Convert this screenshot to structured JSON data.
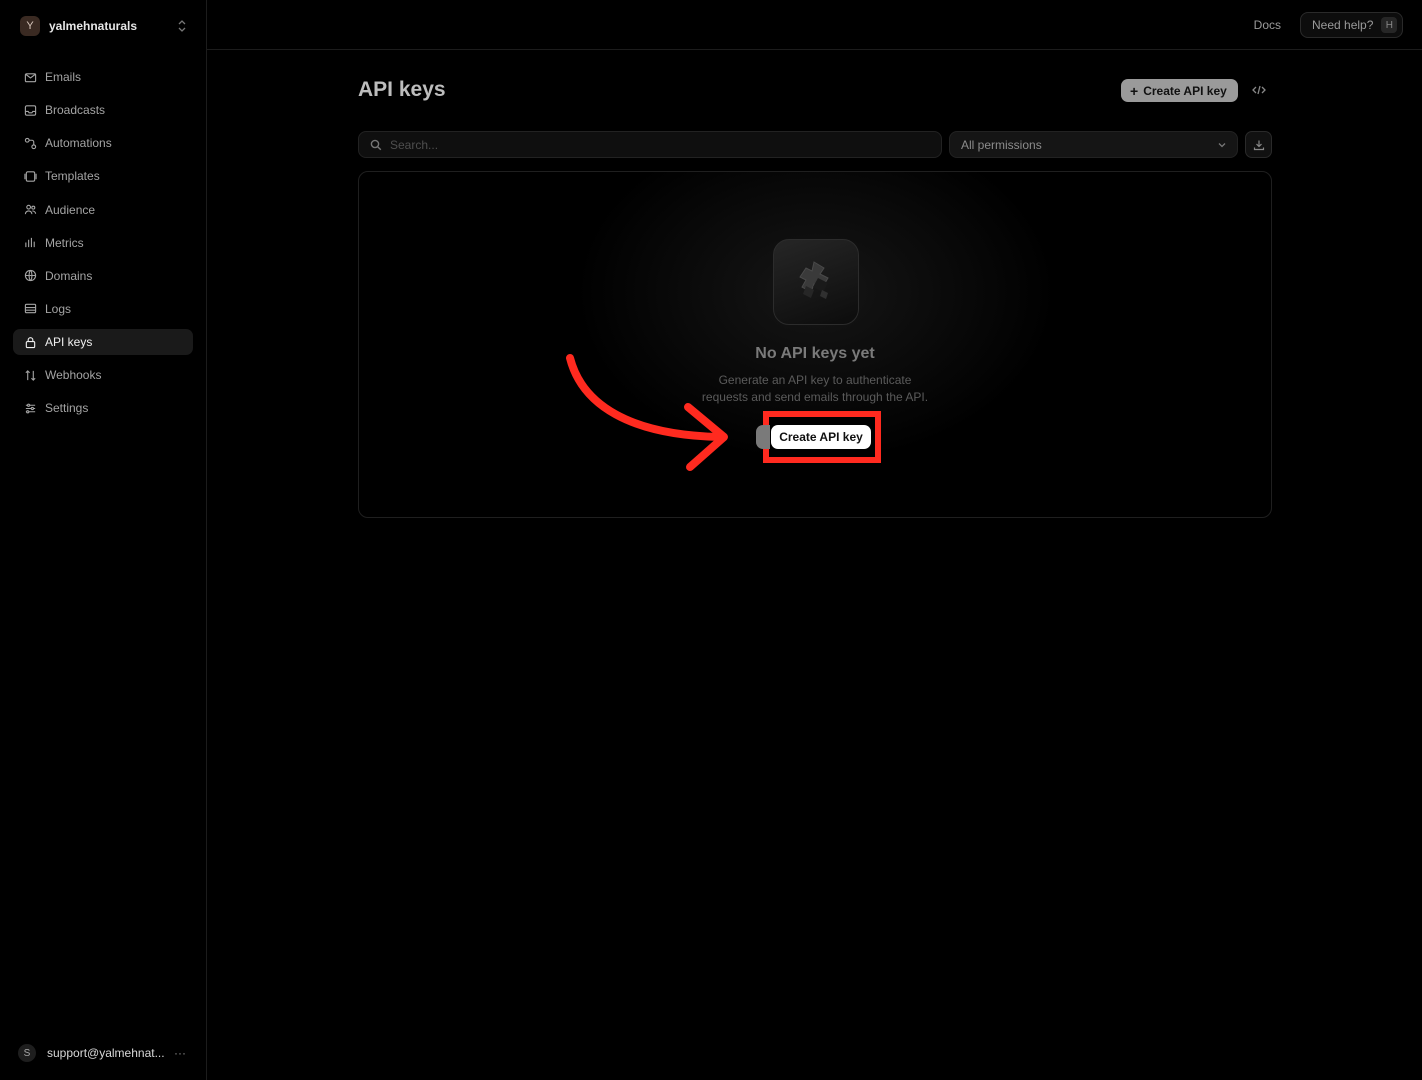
{
  "workspace": {
    "initial": "Y",
    "name": "yalmehnaturals"
  },
  "sidebar": {
    "items": [
      {
        "label": "Emails",
        "icon": "mail-icon"
      },
      {
        "label": "Broadcasts",
        "icon": "inbox-icon"
      },
      {
        "label": "Automations",
        "icon": "automation-icon"
      },
      {
        "label": "Templates",
        "icon": "template-icon"
      },
      {
        "label": "Audience",
        "icon": "users-icon"
      },
      {
        "label": "Metrics",
        "icon": "bar-chart-icon"
      },
      {
        "label": "Domains",
        "icon": "globe-icon"
      },
      {
        "label": "Logs",
        "icon": "list-icon"
      },
      {
        "label": "API keys",
        "icon": "lock-icon",
        "active": true
      },
      {
        "label": "Webhooks",
        "icon": "webhook-icon"
      },
      {
        "label": "Settings",
        "icon": "sliders-icon"
      }
    ]
  },
  "user": {
    "initial": "S",
    "email": "support@yalmehnat...",
    "more": "···"
  },
  "topbar": {
    "docs_label": "Docs",
    "help_label": "Need help?",
    "help_shortcut": "H"
  },
  "main": {
    "title": "API keys",
    "create_button_label": "Create API key",
    "search_placeholder": "Search...",
    "permissions_filter": "All permissions"
  },
  "empty_state": {
    "title": "No API keys yet",
    "description_line1": "Generate an API key to authenticate",
    "description_line2": "requests and send emails through the API.",
    "cta_label": "Create API key"
  },
  "colors": {
    "highlight": "#ff2a1f",
    "background": "#000000"
  }
}
